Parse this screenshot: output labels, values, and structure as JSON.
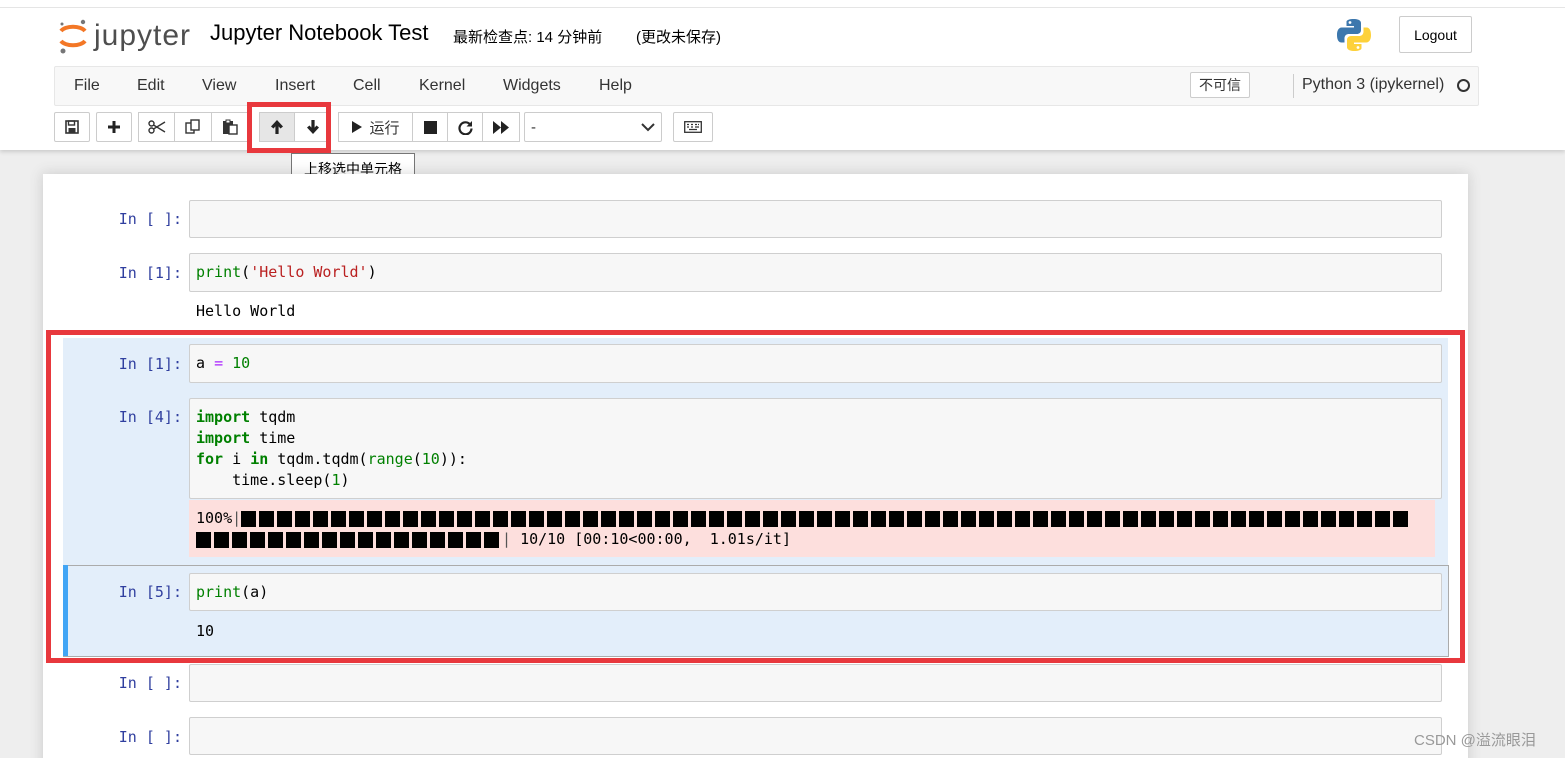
{
  "header": {
    "logo_text": "jupyter",
    "notebook_name": "Jupyter Notebook Test",
    "checkpoint": "最新检查点: 14 分钟前",
    "autosave": "(更改未保存)",
    "logout_label": "Logout"
  },
  "menubar": {
    "items": [
      "File",
      "Edit",
      "View",
      "Insert",
      "Cell",
      "Kernel",
      "Widgets",
      "Help"
    ],
    "trusted": "不可信",
    "kernel": "Python 3 (ipykernel)"
  },
  "toolbar": {
    "buttons": [
      "save-icon",
      "plus-icon",
      "cut-icon",
      "copy-icon",
      "paste-icon",
      "arrow-up-icon",
      "arrow-down-icon",
      "run-icon",
      "stop-icon",
      "restart-icon",
      "fast-forward-icon",
      "keyboard-icon"
    ],
    "run_label": "运行",
    "cell_type_value": "-",
    "tooltip": "上移选中单元格"
  },
  "cells": [
    {
      "prompt": "In [ ]:",
      "code": "",
      "output": ""
    },
    {
      "prompt": "In [1]:",
      "code": "print('Hello World')",
      "output": "Hello World"
    },
    {
      "prompt": "In [1]:",
      "code": "a = 10",
      "output": ""
    },
    {
      "prompt": "In [4]:",
      "code": "import tqdm\nimport time\nfor i in tqdm.tqdm(range(10)):\n    time.sleep(1)",
      "stderr": {
        "percent": "100%",
        "progress": 1.0,
        "stats": "10/10 [00:10<00:00,  1.01s/it]"
      }
    },
    {
      "prompt": "In [5]:",
      "code": "print(a)",
      "output": "10"
    },
    {
      "prompt": "In [ ]:",
      "code": "",
      "output": ""
    },
    {
      "prompt": "In [ ]:",
      "code": "",
      "output": ""
    }
  ],
  "watermark": "CSDN @溢流眼泪",
  "colors": {
    "highlight_red": "#e8383d",
    "selected_bg": "#e3eefa",
    "selected_bar": "#42a5f5",
    "prompt": "#303f9f"
  }
}
